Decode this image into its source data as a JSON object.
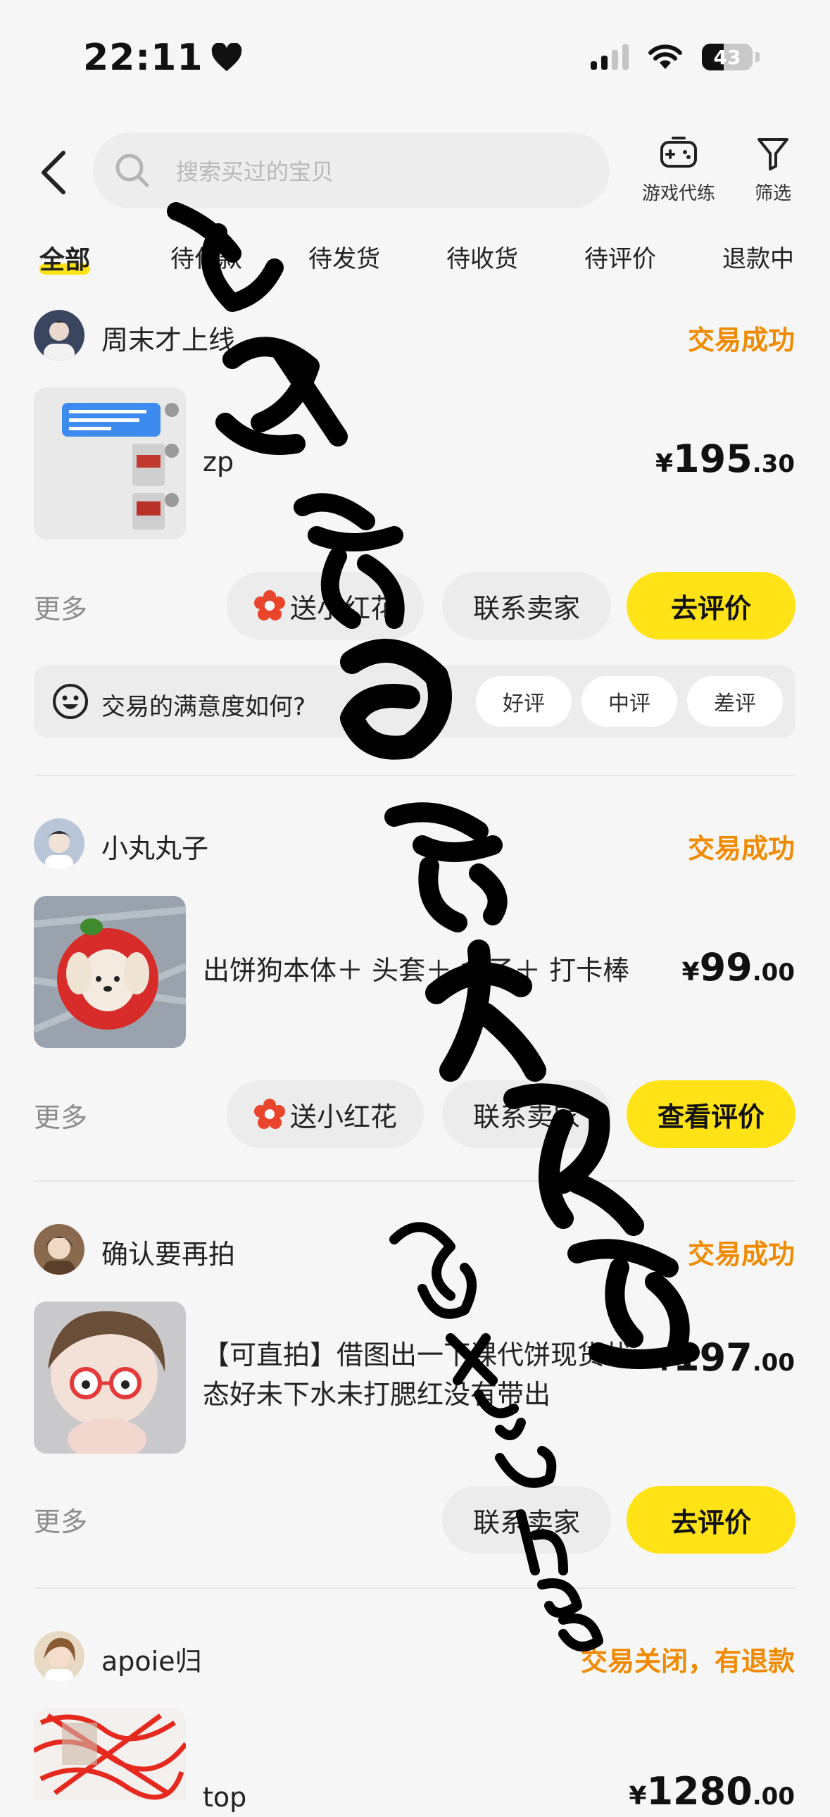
{
  "status_bar": {
    "time": "22:11",
    "battery": "43"
  },
  "header": {
    "search_placeholder": "搜索买过的宝贝",
    "tools": [
      {
        "label": "游戏代练",
        "icon": "gamepad-icon"
      },
      {
        "label": "筛选",
        "icon": "filter-icon"
      }
    ]
  },
  "tabs": [
    "全部",
    "待付款",
    "待发货",
    "待收货",
    "待评价",
    "退款中"
  ],
  "orders": [
    {
      "shop": "周末才上线",
      "status": "交易成功",
      "title": "zp",
      "price": {
        "currency": "¥",
        "int": "195",
        "dec": ".30"
      },
      "more": "更多",
      "actions": [
        "送小红花",
        "联系卖家",
        "去评价"
      ],
      "rating": {
        "question": "交易的满意度如何?",
        "options": [
          "好评",
          "中评",
          "差评"
        ]
      }
    },
    {
      "shop": "小丸丸子",
      "status": "交易成功",
      "title": "出饼狗本体＋ 头套＋ 盒子＋ 打卡棒",
      "price": {
        "currency": "¥",
        "int": "99",
        "dec": ".00"
      },
      "more": "更多",
      "actions": [
        "送小红花",
        "联系卖家",
        "查看评价"
      ]
    },
    {
      "shop": "确认要再拍",
      "status": "交易成功",
      "title": "【可直拍】借图出一下课代饼现货状态好未下水未打腮红没有带出",
      "price": {
        "currency": "¥",
        "int": "197",
        "dec": ".00"
      },
      "more": "更多",
      "actions": [
        "联系卖家",
        "去评价"
      ]
    },
    {
      "shop": "apoie归",
      "status": "交易关闭，有退款",
      "title": "top",
      "price": {
        "currency": "¥",
        "int": "1280",
        "dec": ".00"
      }
    }
  ],
  "watermark": {
    "text": "永安巷鱼缸大眼猫 suxinhao"
  },
  "colors": {
    "accent_yellow": "#ffe316",
    "status_orange": "#f08a00",
    "flower_red": "#e8452c"
  }
}
